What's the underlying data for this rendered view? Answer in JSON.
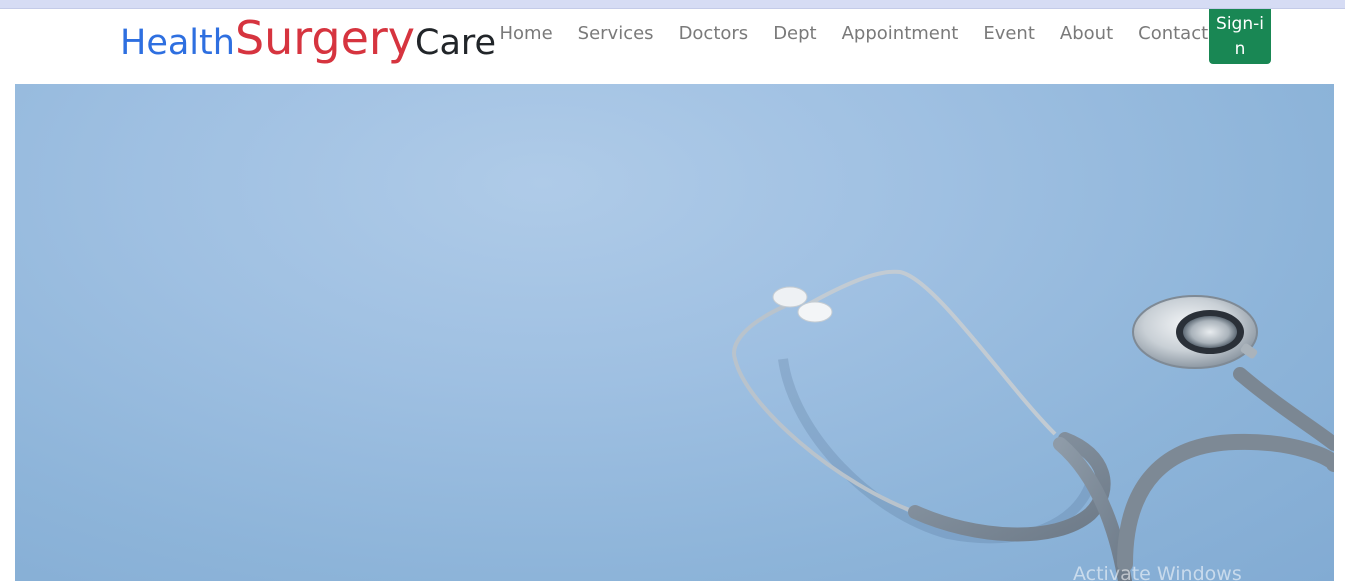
{
  "brand": {
    "part1": "Health",
    "part2": "Surgery",
    "part3": "Care"
  },
  "nav": {
    "items": [
      {
        "label": "Home"
      },
      {
        "label": "Services"
      },
      {
        "label": "Doctors"
      },
      {
        "label": "Dept"
      },
      {
        "label": "Appointment"
      },
      {
        "label": "Event"
      },
      {
        "label": "About"
      },
      {
        "label": "Contact"
      }
    ],
    "signin_label": "Sign-in"
  },
  "hero": {
    "image": "stethoscope-photo"
  },
  "watermark": {
    "text": "Activate Windows"
  },
  "colors": {
    "brand_blue": "#2e6fe0",
    "brand_red": "#d6343f",
    "brand_dark": "#212529",
    "signin_green": "#198754",
    "hero_bg": "#9fc0e2"
  }
}
